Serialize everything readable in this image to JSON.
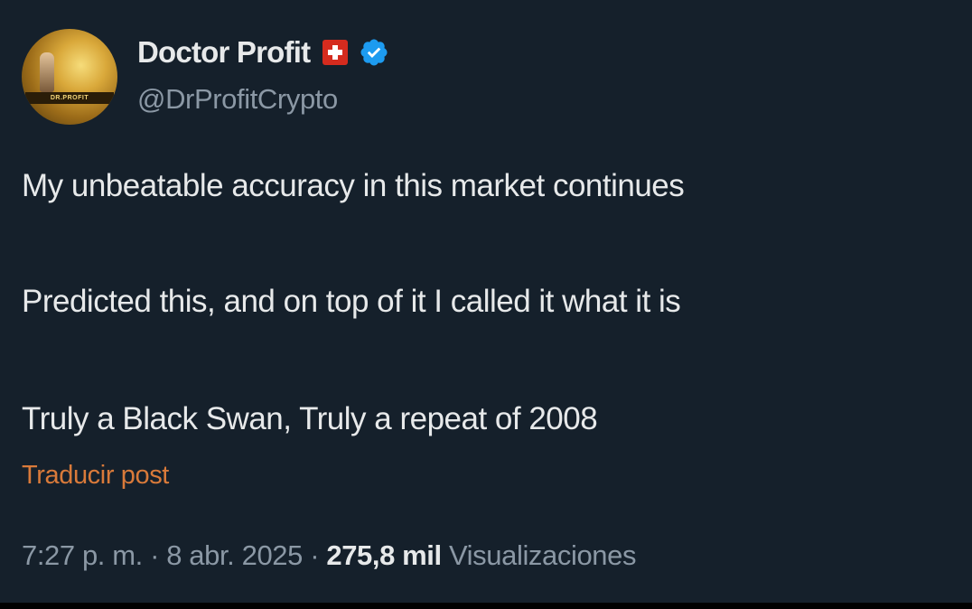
{
  "author": {
    "display_name": "Doctor Profit",
    "handle": "@DrProfitCrypto",
    "avatar_text": "DR.PROFIT",
    "flag_icon": "switzerland-flag-icon",
    "badge_icon": "verified-badge-icon",
    "badge_color": "#1d9bf0"
  },
  "tweet": {
    "lines": [
      "My unbeatable accuracy in this market continues",
      "Predicted this, and on top of it I called it what it is",
      "Truly a Black Swan, Truly a repeat of 2008"
    ],
    "translate_label": "Traducir post"
  },
  "meta": {
    "time": "7:27 p. m.",
    "separator": "·",
    "date": "8 abr. 2025",
    "views_count": "275,8 mil",
    "views_label": "Visualizaciones"
  },
  "colors": {
    "background": "#15202b",
    "text": "#e7e9ea",
    "secondary_text": "#8b98a5",
    "translate_link": "#d97a3a"
  }
}
